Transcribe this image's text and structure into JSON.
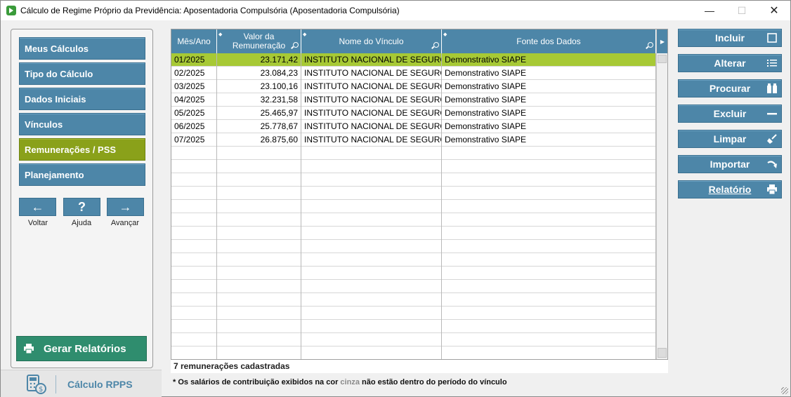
{
  "window": {
    "title": "Cálculo de Regime Próprio da Previdência: Aposentadoria Compulsória (Aposentadoria Compulsória)",
    "minimize": "—",
    "maximize": "☐",
    "close": "✕"
  },
  "sidebar": {
    "items": [
      {
        "label": "Meus Cálculos",
        "active": false
      },
      {
        "label": "Tipo do Cálculo",
        "active": false
      },
      {
        "label": "Dados Iniciais",
        "active": false
      },
      {
        "label": "Vínculos",
        "active": false
      },
      {
        "label": "Remunerações / PSS",
        "active": true
      },
      {
        "label": "Planejamento",
        "active": false
      }
    ],
    "nav": {
      "back_icon": "←",
      "back_label": "Voltar",
      "help_icon": "?",
      "help_label": "Ajuda",
      "forward_icon": "→",
      "forward_label": "Avançar"
    },
    "generate_reports_label": "Gerar Relatórios",
    "brand_name": "Cálculo RPPS"
  },
  "grid": {
    "columns": [
      "Mês/Ano",
      "Valor da Remuneração",
      "Nome do Vínculo",
      "Fonte dos Dados"
    ],
    "rows": [
      [
        "01/2025",
        "23.171,42",
        "INSTITUTO NACIONAL DE SEGURO SOCIAL",
        "Demonstrativo SIAPE"
      ],
      [
        "02/2025",
        "23.084,23",
        "INSTITUTO NACIONAL DE SEGURO SOCIAL",
        "Demonstrativo SIAPE"
      ],
      [
        "03/2025",
        "23.100,16",
        "INSTITUTO NACIONAL DE SEGURO SOCIAL",
        "Demonstrativo SIAPE"
      ],
      [
        "04/2025",
        "32.231,58",
        "INSTITUTO NACIONAL DE SEGURO SOCIAL",
        "Demonstrativo SIAPE"
      ],
      [
        "05/2025",
        "25.465,97",
        "INSTITUTO NACIONAL DE SEGURO SOCIAL",
        "Demonstrativo SIAPE"
      ],
      [
        "06/2025",
        "25.778,67",
        "INSTITUTO NACIONAL DE SEGURO SOCIAL",
        "Demonstrativo SIAPE"
      ],
      [
        "07/2025",
        "26.875,60",
        "INSTITUTO NACIONAL DE SEGURO SOCIAL",
        "Demonstrativo SIAPE"
      ]
    ],
    "selected_row": 0,
    "selected_color": "#a7c935"
  },
  "status": {
    "count_text": "7 remunerações cadastradas",
    "footnote_before": "* Os salários de contribuição exibidos na cor ",
    "footnote_gray": "cinza",
    "footnote_after": " não estão dentro do período do vínculo"
  },
  "actions": [
    {
      "label": "Incluir",
      "icon": "square-icon"
    },
    {
      "label": "Alterar",
      "icon": "list-icon"
    },
    {
      "label": "Procurar",
      "icon": "binoculars-icon"
    },
    {
      "label": "Excluir",
      "icon": "minus-icon"
    },
    {
      "label": "Limpar",
      "icon": "broom-icon"
    },
    {
      "label": "Importar",
      "icon": "import-icon"
    },
    {
      "label": "Relatório",
      "icon": "printer-icon"
    }
  ],
  "colors": {
    "primary": "#4d86a8",
    "active": "#8aa11a",
    "generate": "#2f8d6e"
  }
}
